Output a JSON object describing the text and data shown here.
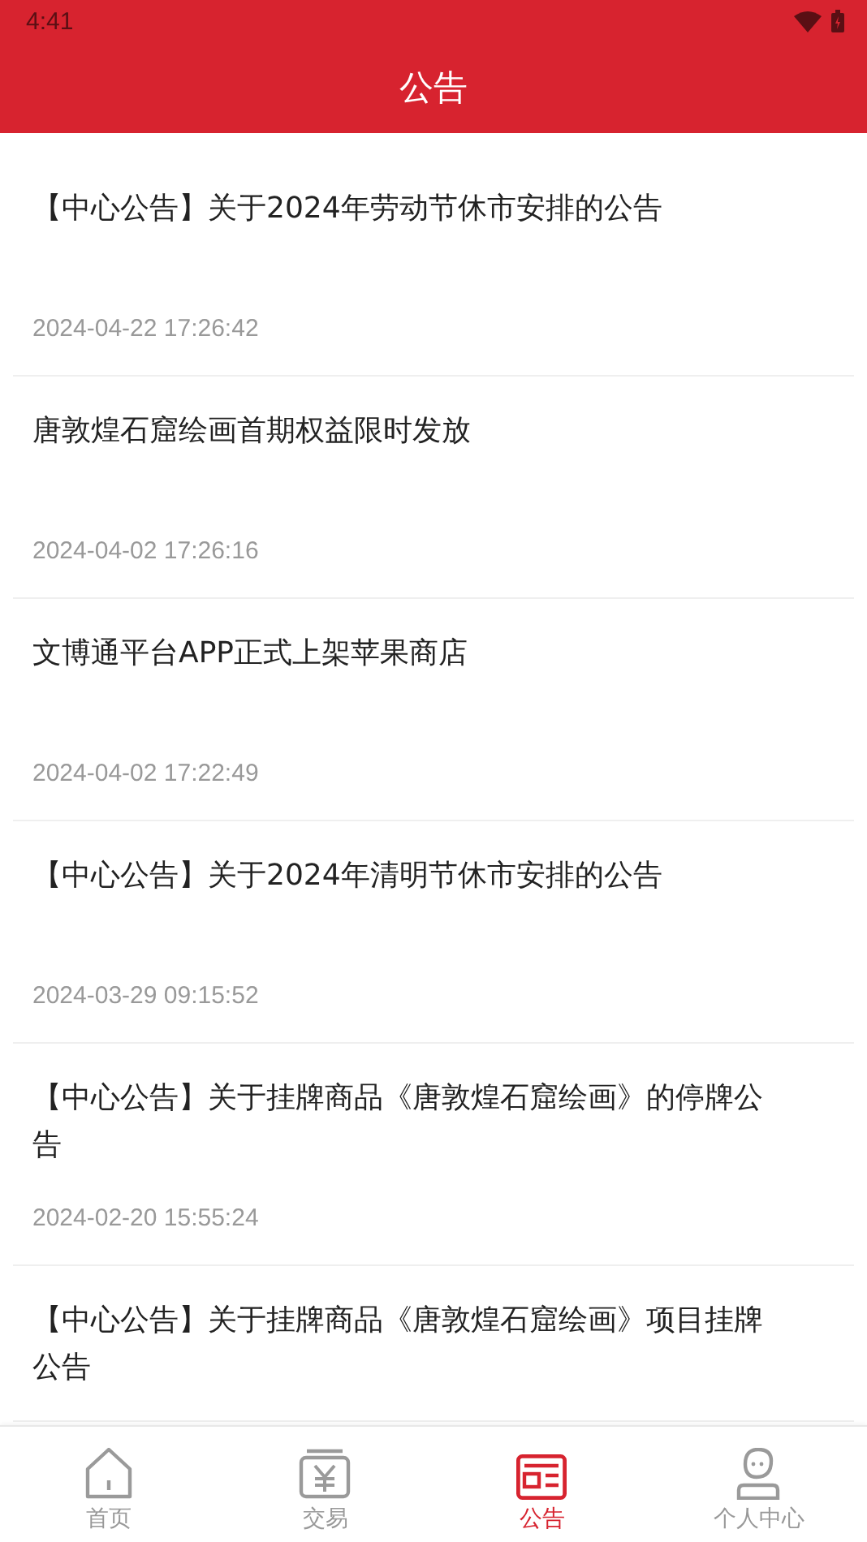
{
  "status_bar": {
    "time": "4:41"
  },
  "header": {
    "title": "公告"
  },
  "announcements": [
    {
      "title": "【中心公告】关于2024年劳动节休市安排的公告",
      "date": "2024-04-22 17:26:42"
    },
    {
      "title": "唐敦煌石窟绘画首期权益限时发放",
      "date": "2024-04-02 17:26:16"
    },
    {
      "title": "文博通平台APP正式上架苹果商店",
      "date": "2024-04-02 17:22:49"
    },
    {
      "title": "【中心公告】关于2024年清明节休市安排的公告",
      "date": "2024-03-29 09:15:52"
    },
    {
      "title": "【中心公告】关于挂牌商品《唐敦煌石窟绘画》的停牌公告",
      "date": "2024-02-20 15:55:24"
    },
    {
      "title": "【中心公告】关于挂牌商品《唐敦煌石窟绘画》项目挂牌公告"
    }
  ],
  "tab_bar": [
    {
      "label": "首页",
      "kind": "home",
      "selected": false
    },
    {
      "label": "交易",
      "kind": "trade",
      "selected": false
    },
    {
      "label": "公告",
      "kind": "notice",
      "selected": true
    },
    {
      "label": "个人中心",
      "kind": "profile",
      "selected": false
    }
  ]
}
